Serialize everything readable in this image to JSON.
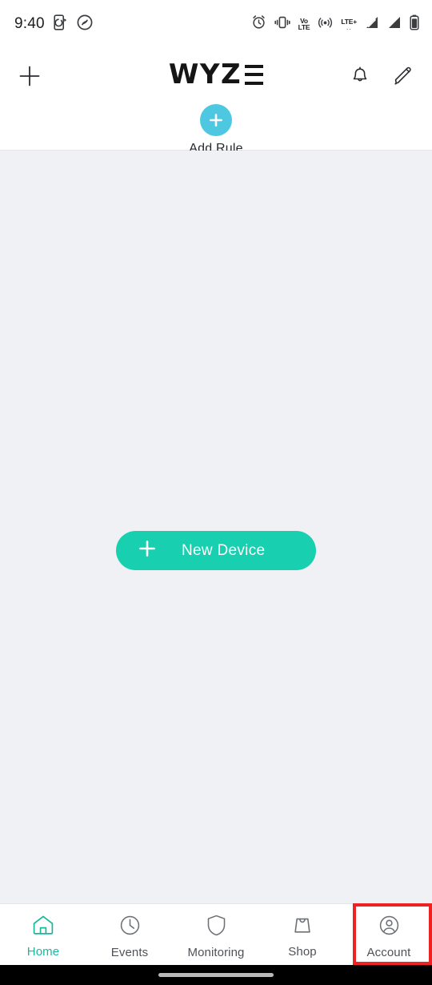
{
  "status_bar": {
    "time": "9:40",
    "left_icons": [
      "screen-cast-icon",
      "shazam-icon"
    ],
    "right_icons": [
      "alarm-icon",
      "vibrate-icon",
      "volte-icon",
      "hotspot-icon",
      "lte-plus-icon",
      "signal-1-icon",
      "signal-2-icon",
      "battery-icon"
    ],
    "volte_top": "VoLTE",
    "volte_line1": "Vo",
    "volte_line2": "LTE",
    "lte_label": "LTE+",
    "lte_dots": ".."
  },
  "header": {
    "add_icon": "plus-icon",
    "logo_text": "WYZ",
    "logo_alt": "WYZE",
    "notifications_icon": "bell-icon",
    "edit_icon": "pencil-icon",
    "add_rule": {
      "icon": "plus-icon",
      "label": "Add Rule"
    }
  },
  "main": {
    "new_device_button": {
      "icon": "plus-icon",
      "label": "New Device"
    }
  },
  "bottom_nav": {
    "items": [
      {
        "label": "Home",
        "icon": "home-icon",
        "active": true
      },
      {
        "label": "Events",
        "icon": "clock-icon",
        "active": false
      },
      {
        "label": "Monitoring",
        "icon": "shield-icon",
        "active": false
      },
      {
        "label": "Shop",
        "icon": "shopping-bag-icon",
        "active": false
      },
      {
        "label": "Account",
        "icon": "account-icon",
        "active": false
      }
    ],
    "highlighted_item": "Account"
  },
  "colors": {
    "accent_teal": "#18cfb0",
    "accent_cyan": "#4ec8e0",
    "active_nav": "#18b89c",
    "highlight": "#ee2222",
    "background": "#eff1f5",
    "surface": "#ffffff"
  }
}
